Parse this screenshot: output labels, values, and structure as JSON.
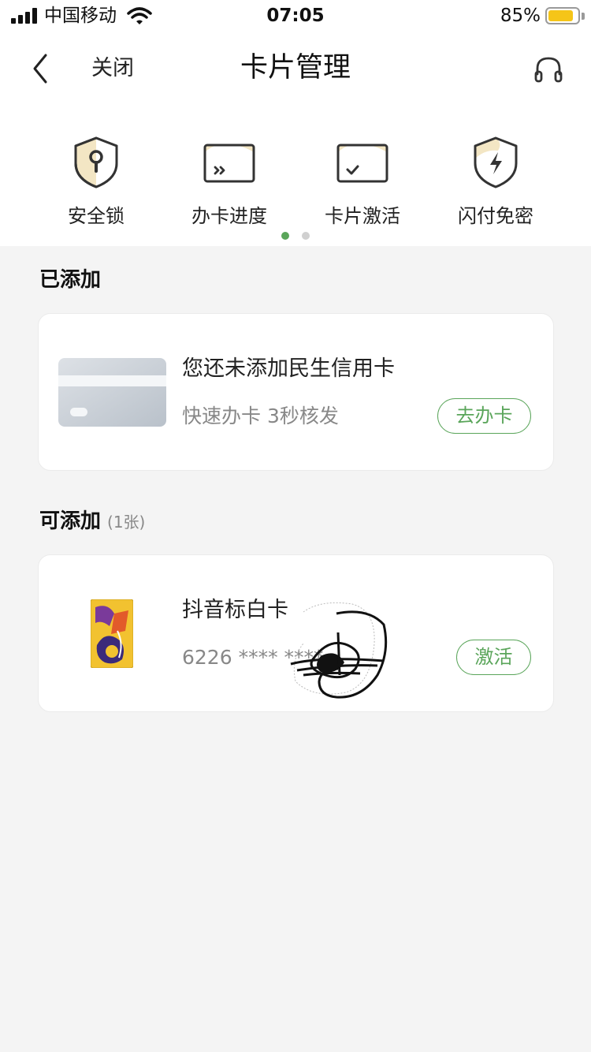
{
  "status": {
    "carrier": "中国移动",
    "time": "07:05",
    "battery_percent": "85%",
    "battery_level": 0.85,
    "battery_color": "#f5c518"
  },
  "nav": {
    "back_icon": "chevron-left-icon",
    "close_label": "关闭",
    "title": "卡片管理",
    "service_icon": "headphones-icon"
  },
  "quick_actions": [
    {
      "label": "安全锁",
      "icon": "security-lock-icon"
    },
    {
      "label": "办卡进度",
      "icon": "application-progress-icon"
    },
    {
      "label": "卡片激活",
      "icon": "card-activate-icon"
    },
    {
      "label": "闪付免密",
      "icon": "quickpay-shield-icon"
    }
  ],
  "pager": {
    "pages": 2,
    "active": 1
  },
  "added": {
    "title": "已添加",
    "card": {
      "thumb_icon": "credit-card-placeholder-icon",
      "title": "您还未添加民生信用卡",
      "subtitle": "快速办卡 3秒核发",
      "button_label": "去办卡"
    }
  },
  "addable": {
    "title": "可添加",
    "count": "(1张)",
    "card": {
      "thumb_icon": "card-art-thumbnail",
      "title": "抖音标白卡",
      "number": "6226 **** ****",
      "button_label": "激活"
    }
  },
  "colors": {
    "accent": "#5aa55a",
    "background": "#f4f4f4",
    "card_gold": "#f3e6c4"
  }
}
